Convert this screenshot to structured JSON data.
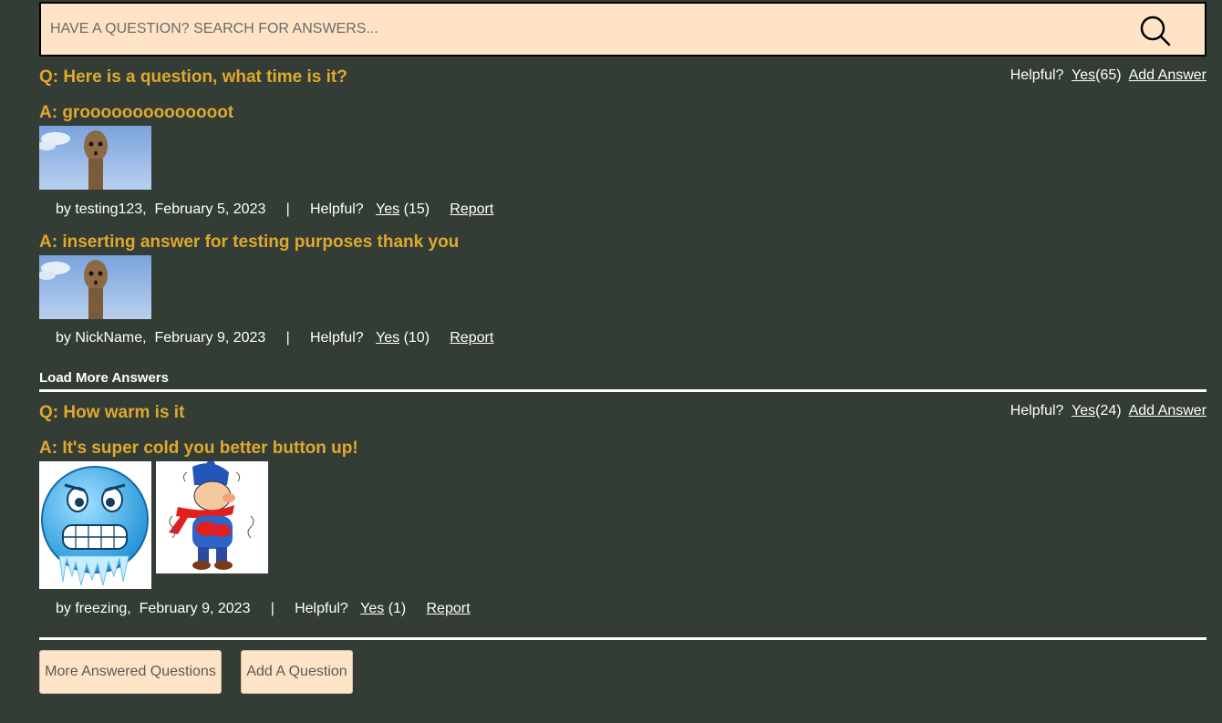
{
  "search": {
    "placeholder": "HAVE A QUESTION? SEARCH FOR ANSWERS...",
    "icon": "search-icon"
  },
  "questions": [
    {
      "text": "Q: Here is a question, what time is it?",
      "helpful_label": "Helpful?",
      "yes_label": "Yes",
      "yes_count": "(65)",
      "add_answer_label": "Add Answer",
      "answers": [
        {
          "text": "A: groooooooooooooot",
          "by": "by testing123,",
          "date": "February 5, 2023",
          "sep": "|",
          "helpful_label": "Helpful?",
          "yes_label": "Yes",
          "yes_count": "(15)",
          "report_label": "Report"
        },
        {
          "text": "A: inserting answer for testing purposes thank you",
          "by": "by NickName,",
          "date": "February 9, 2023",
          "sep": "|",
          "helpful_label": "Helpful?",
          "yes_label": "Yes",
          "yes_count": "(10)",
          "report_label": "Report"
        }
      ],
      "load_more_label": "Load More Answers"
    },
    {
      "text": "Q: How warm is it",
      "helpful_label": "Helpful?",
      "yes_label": "Yes",
      "yes_count": "(24)",
      "add_answer_label": "Add Answer",
      "answers": [
        {
          "text": "A: It's super cold you better button up!",
          "by": "by freezing,",
          "date": "February 9, 2023",
          "sep": "|",
          "helpful_label": "Helpful?",
          "yes_label": "Yes",
          "yes_count": "(1)",
          "report_label": "Report"
        }
      ]
    }
  ],
  "footer": {
    "more_questions_label": "More Answered Questions",
    "add_question_label": "Add A Question"
  },
  "colors": {
    "background": "#333d35",
    "accent": "#e0a82e",
    "button_bg": "#ffe3c6"
  }
}
